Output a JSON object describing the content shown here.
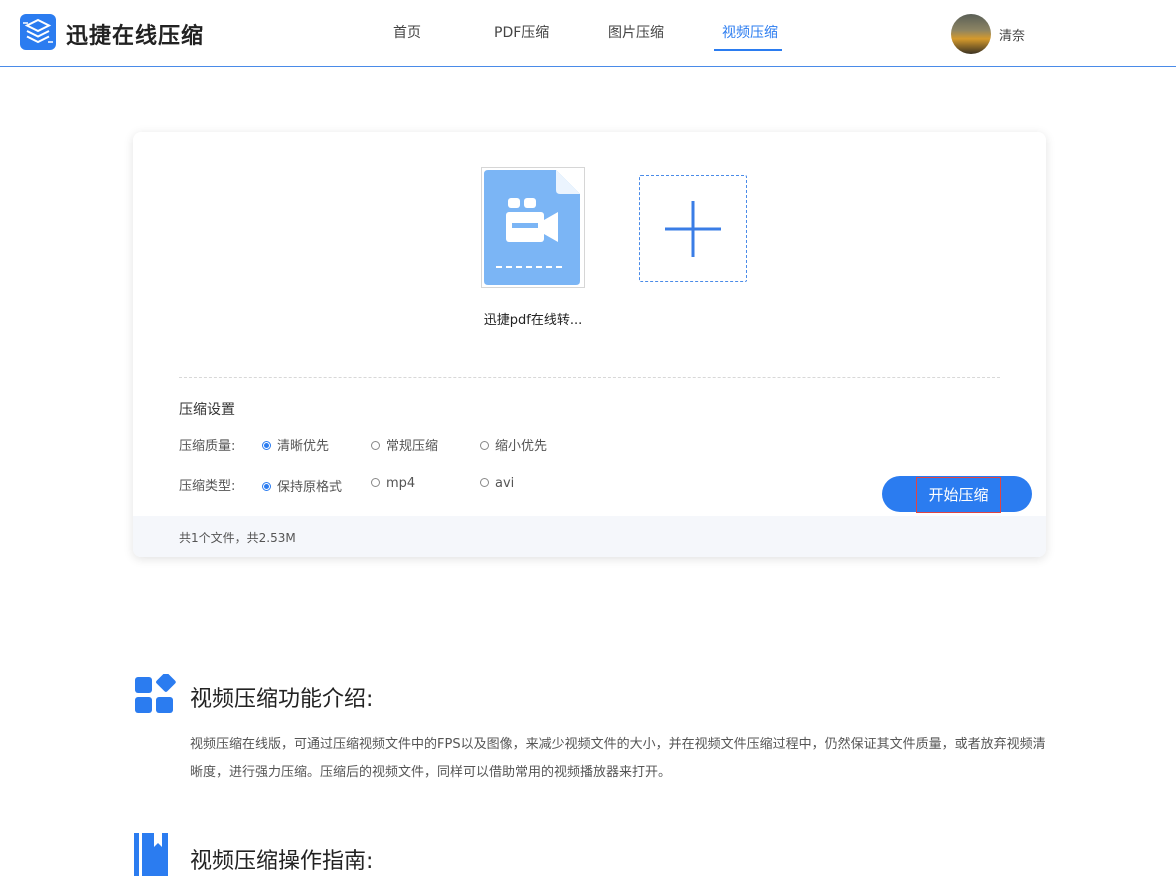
{
  "header": {
    "brand": "迅捷在线压缩",
    "nav": [
      {
        "label": "首页"
      },
      {
        "label": "PDF压缩"
      },
      {
        "label": "图片压缩"
      },
      {
        "label": "视频压缩"
      }
    ],
    "active_nav": "视频压缩",
    "username": "清奈"
  },
  "upload": {
    "file_name": "迅捷pdf在线转...",
    "add_icon": "plus-icon"
  },
  "settings": {
    "title": "压缩设置",
    "quality": {
      "label": "压缩质量:",
      "options": [
        "清晰优先",
        "常规压缩",
        "缩小优先"
      ],
      "selected": "清晰优先"
    },
    "type": {
      "label": "压缩类型:",
      "options": [
        "保持原格式",
        "mp4",
        "avi"
      ],
      "selected": "保持原格式"
    },
    "start_button": "开始压缩"
  },
  "summary": "共1个文件，共2.53M",
  "intro": {
    "title": "视频压缩功能介绍:",
    "text": "视频压缩在线版，可通过压缩视频文件中的FPS以及图像，来减少视频文件的大小，并在视频文件压缩过程中，仍然保证其文件质量，或者放弃视频清晰度，进行强力压缩。压缩后的视频文件，同样可以借助常用的视频播放器来打开。"
  },
  "guide": {
    "title": "视频压缩操作指南:"
  },
  "colors": {
    "accent": "#2b7cf0",
    "file_icon": "#7bb5f5",
    "highlight_border": "#e04444"
  }
}
